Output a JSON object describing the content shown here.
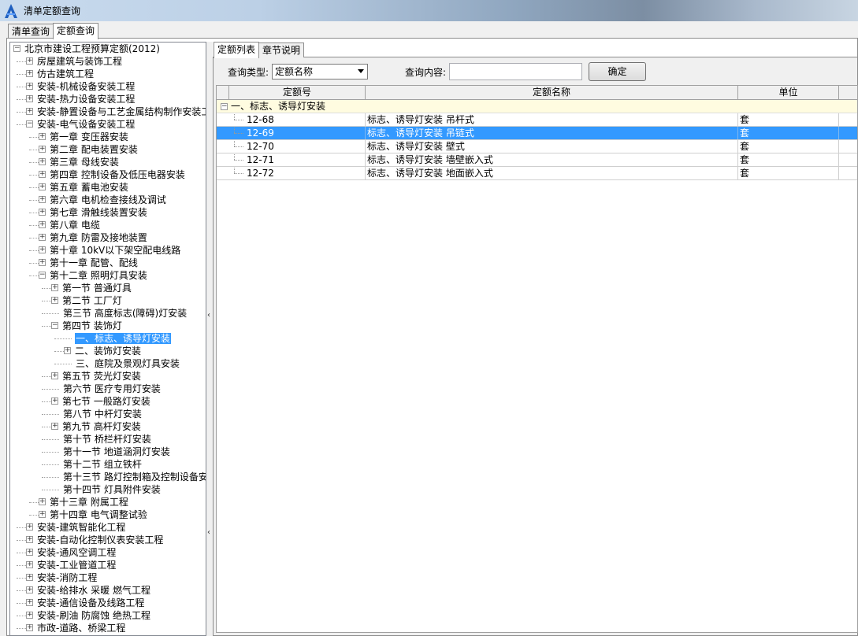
{
  "window": {
    "title": "清单定额查询"
  },
  "top_tabs": [
    {
      "label": "清单查询",
      "active": false
    },
    {
      "label": "定额查询",
      "active": true
    }
  ],
  "tree": {
    "nodes": [
      {
        "label": "北京市建设工程预算定额(2012)",
        "level": 0,
        "expander": "minus"
      },
      {
        "label": "房屋建筑与装饰工程",
        "level": 1,
        "expander": "plus"
      },
      {
        "label": "仿古建筑工程",
        "level": 1,
        "expander": "plus"
      },
      {
        "label": "安装-机械设备安装工程",
        "level": 1,
        "expander": "plus"
      },
      {
        "label": "安装-热力设备安装工程",
        "level": 1,
        "expander": "plus"
      },
      {
        "label": "安装-静置设备与工艺金属结构制作安装工",
        "level": 1,
        "expander": "plus"
      },
      {
        "label": "安装-电气设备安装工程",
        "level": 1,
        "expander": "minus"
      },
      {
        "label": "第一章 变压器安装",
        "level": 2,
        "expander": "plus"
      },
      {
        "label": "第二章 配电装置安装",
        "level": 2,
        "expander": "plus"
      },
      {
        "label": "第三章 母线安装",
        "level": 2,
        "expander": "plus"
      },
      {
        "label": "第四章 控制设备及低压电器安装",
        "level": 2,
        "expander": "plus"
      },
      {
        "label": "第五章 蓄电池安装",
        "level": 2,
        "expander": "plus"
      },
      {
        "label": "第六章 电机检查接线及调试",
        "level": 2,
        "expander": "plus"
      },
      {
        "label": "第七章 滑触线装置安装",
        "level": 2,
        "expander": "plus"
      },
      {
        "label": "第八章 电缆",
        "level": 2,
        "expander": "plus"
      },
      {
        "label": "第九章 防雷及接地装置",
        "level": 2,
        "expander": "plus"
      },
      {
        "label": "第十章 10kV以下架空配电线路",
        "level": 2,
        "expander": "plus"
      },
      {
        "label": "第十一章 配管、配线",
        "level": 2,
        "expander": "plus"
      },
      {
        "label": "第十二章 照明灯具安装",
        "level": 2,
        "expander": "minus"
      },
      {
        "label": "第一节 普通灯具",
        "level": 3,
        "expander": "plus"
      },
      {
        "label": "第二节 工厂灯",
        "level": 3,
        "expander": "plus"
      },
      {
        "label": "第三节 高度标志(障碍)灯安装",
        "level": 3,
        "expander": "none"
      },
      {
        "label": "第四节 装饰灯",
        "level": 3,
        "expander": "minus"
      },
      {
        "label": "一、标志、诱导灯安装",
        "level": 4,
        "expander": "none",
        "selected": true
      },
      {
        "label": "二、装饰灯安装",
        "level": 4,
        "expander": "plus"
      },
      {
        "label": "三、庭院及景观灯具安装",
        "level": 4,
        "expander": "none"
      },
      {
        "label": "第五节 荧光灯安装",
        "level": 3,
        "expander": "plus"
      },
      {
        "label": "第六节 医疗专用灯安装",
        "level": 3,
        "expander": "none"
      },
      {
        "label": "第七节 一般路灯安装",
        "level": 3,
        "expander": "plus"
      },
      {
        "label": "第八节 中杆灯安装",
        "level": 3,
        "expander": "none"
      },
      {
        "label": "第九节 高杆灯安装",
        "level": 3,
        "expander": "plus"
      },
      {
        "label": "第十节 桥栏杆灯安装",
        "level": 3,
        "expander": "none"
      },
      {
        "label": "第十一节 地道涵洞灯安装",
        "level": 3,
        "expander": "none"
      },
      {
        "label": "第十二节 组立铁杆",
        "level": 3,
        "expander": "none"
      },
      {
        "label": "第十三节 路灯控制箱及控制设备安",
        "level": 3,
        "expander": "none"
      },
      {
        "label": "第十四节 灯具附件安装",
        "level": 3,
        "expander": "none"
      },
      {
        "label": "第十三章 附属工程",
        "level": 2,
        "expander": "plus"
      },
      {
        "label": "第十四章 电气调整试验",
        "level": 2,
        "expander": "plus"
      },
      {
        "label": "安装-建筑智能化工程",
        "level": 1,
        "expander": "plus"
      },
      {
        "label": "安装-自动化控制仪表安装工程",
        "level": 1,
        "expander": "plus"
      },
      {
        "label": "安装-通风空调工程",
        "level": 1,
        "expander": "plus"
      },
      {
        "label": "安装-工业管道工程",
        "level": 1,
        "expander": "plus"
      },
      {
        "label": "安装-消防工程",
        "level": 1,
        "expander": "plus"
      },
      {
        "label": "安装-给排水 采暖 燃气工程",
        "level": 1,
        "expander": "plus"
      },
      {
        "label": "安装-通信设备及线路工程",
        "level": 1,
        "expander": "plus"
      },
      {
        "label": "安装-刷油 防腐蚀 绝热工程",
        "level": 1,
        "expander": "plus"
      },
      {
        "label": "市政-道路、桥梁工程",
        "level": 1,
        "expander": "plus"
      }
    ]
  },
  "right_tabs": [
    {
      "label": "定额列表",
      "active": true
    },
    {
      "label": "章节说明",
      "active": false
    }
  ],
  "query": {
    "type_label": "查询类型:",
    "type_value": "定额名称",
    "content_label": "查询内容:",
    "content_value": "",
    "confirm_label": "确定"
  },
  "grid": {
    "columns": [
      "定额号",
      "定额名称",
      "单位"
    ],
    "group_label": "一、标志、诱导灯安装",
    "rows": [
      {
        "code": "12-68",
        "name": "标志、诱导灯安装 吊杆式",
        "unit": "套",
        "selected": false
      },
      {
        "code": "12-69",
        "name": "标志、诱导灯安装 吊链式",
        "unit": "套",
        "selected": true
      },
      {
        "code": "12-70",
        "name": "标志、诱导灯安装 壁式",
        "unit": "套",
        "selected": false
      },
      {
        "code": "12-71",
        "name": "标志、诱导灯安装 墙壁嵌入式",
        "unit": "套",
        "selected": false
      },
      {
        "code": "12-72",
        "name": "标志、诱导灯安装 地面嵌入式",
        "unit": "套",
        "selected": false
      }
    ]
  },
  "colors": {
    "selection": "#3399ff",
    "group_row": "#fffce0"
  }
}
